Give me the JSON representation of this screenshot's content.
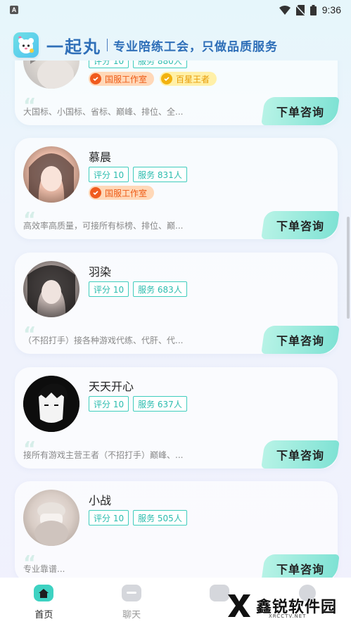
{
  "status_bar": {
    "time": "9:36",
    "left_icon": "A"
  },
  "header": {
    "app_name": "一起丸",
    "slogan": "专业陪练工会，只做品质服务"
  },
  "cards": [
    {
      "name": "",
      "rating": "评分 10",
      "services": "服务 880人",
      "badges": [
        {
          "label": "国服工作室",
          "type": "studio"
        },
        {
          "label": "百星王者",
          "type": "star"
        }
      ],
      "description": "大国标、小国标、省标、巅峰、排位、全...",
      "button": "下单咨询"
    },
    {
      "name": "慕晨",
      "rating": "评分 10",
      "services": "服务 831人",
      "badges": [
        {
          "label": "国服工作室",
          "type": "studio"
        }
      ],
      "description": "高效率高质量，可接所有标榜、排位、巅...",
      "button": "下单咨询"
    },
    {
      "name": "羽染",
      "rating": "评分 10",
      "services": "服务 683人",
      "badges": [],
      "description": "（不招打手）接各种游戏代练、代肝、代...",
      "button": "下单咨询"
    },
    {
      "name": "天天开心",
      "rating": "评分 10",
      "services": "服务 637人",
      "badges": [],
      "description": "接所有游戏主营王者（不招打手）巅峰、...",
      "button": "下单咨询"
    },
    {
      "name": "小战",
      "rating": "评分 10",
      "services": "服务 505人",
      "badges": [],
      "description": "专业靠谱...",
      "button": "下单咨询"
    }
  ],
  "bottom_nav": [
    {
      "label": "首页",
      "icon": "home-icon",
      "active": true
    },
    {
      "label": "聊天",
      "icon": "chat-icon",
      "active": false
    },
    {
      "label": "",
      "icon": "order-icon",
      "active": false
    },
    {
      "label": "",
      "icon": "profile-icon",
      "active": false
    }
  ],
  "watermark": {
    "text": "鑫锐软件园",
    "sub": "XRCCTV.NET"
  },
  "colors": {
    "accent": "#2bbcae",
    "brand_blue": "#2f6fb8",
    "studio_badge": "#ee5b16",
    "star_badge": "#e79b06"
  }
}
